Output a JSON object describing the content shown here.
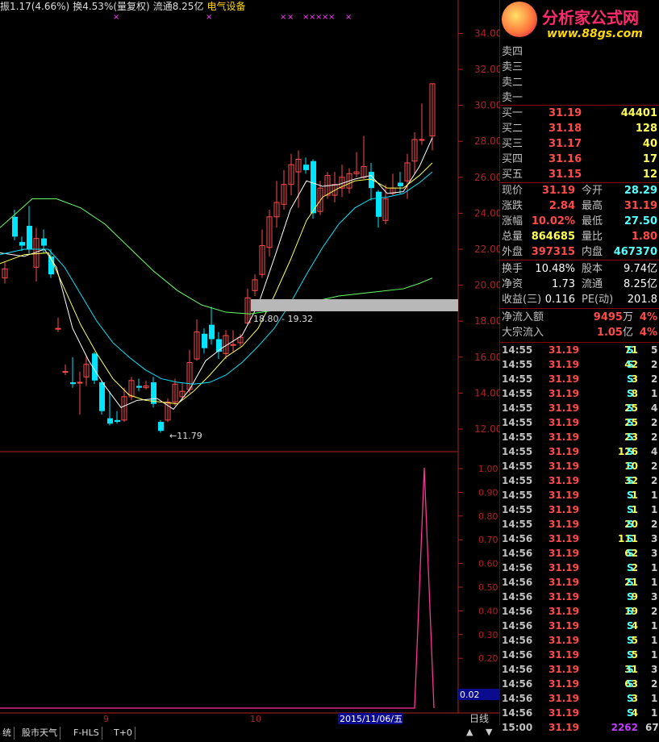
{
  "header": {
    "amp": "振1.17(4.66%)",
    "turnover": "换4.53%(量复权)",
    "float": "流通8.25亿",
    "sector": "电气设备"
  },
  "logo": {
    "name": "分析家公式网",
    "url": "www.88gs.com"
  },
  "price_axis": [
    "34.00",
    "32.00",
    "30.00",
    "28.00",
    "26.00",
    "24.00",
    "22.00",
    "20.00",
    "18.00",
    "16.00",
    "14.00",
    "12.00"
  ],
  "ind_axis": [
    "1.00",
    "0.90",
    "0.80",
    "0.70",
    "0.60",
    "0.50",
    "0.40",
    "0.30",
    "0.20"
  ],
  "ind_value": "0.02",
  "labels": {
    "range": "18.80 - 19.32",
    "low": "11.79",
    "date": "2015/11/06/五",
    "m9": "9",
    "m10": "10",
    "period": "日线"
  },
  "bottom_tabs": [
    "统",
    "股市天气",
    "F-HLS",
    "T+0"
  ],
  "sell": [
    {
      "label": "卖四"
    },
    {
      "label": "卖三"
    },
    {
      "label": "卖二"
    },
    {
      "label": "卖一"
    }
  ],
  "buy": [
    {
      "label": "买一",
      "price": "31.19",
      "vol": "44401"
    },
    {
      "label": "买二",
      "price": "31.18",
      "vol": "128"
    },
    {
      "label": "买三",
      "price": "31.17",
      "vol": "40"
    },
    {
      "label": "买四",
      "price": "31.16",
      "vol": "17"
    },
    {
      "label": "买五",
      "price": "31.15",
      "vol": "12"
    }
  ],
  "stats": [
    {
      "l1": "现价",
      "v1": "31.19",
      "l2": "今开",
      "v2": "28.29",
      "c1": "#ff4a4a",
      "c2": "#5ff"
    },
    {
      "l1": "涨跌",
      "v1": "2.84",
      "l2": "最高",
      "v2": "31.19",
      "c1": "#ff4a4a",
      "c2": "#ff4a4a"
    },
    {
      "l1": "涨幅",
      "v1": "10.02%",
      "l2": "最低",
      "v2": "27.50",
      "c1": "#ff4a4a",
      "c2": "#5ff"
    },
    {
      "l1": "总量",
      "v1": "864685",
      "l2": "量比",
      "v2": "1.80",
      "c1": "#ffff55",
      "c2": "#ff4a4a"
    },
    {
      "l1": "外盘",
      "v1": "397315",
      "l2": "内盘",
      "v2": "467370",
      "c1": "#ff4a4a",
      "c2": "#5ff"
    }
  ],
  "fund": [
    {
      "l1": "换手",
      "v1": "10.48%",
      "l2": "股本",
      "v2": "9.74亿"
    },
    {
      "l1": "净资",
      "v1": "1.73",
      "l2": "流通",
      "v2": "8.25亿"
    },
    {
      "l1": "收益(三)",
      "v1": "0.116",
      "l2": "PE(动)",
      "v2": "201.8"
    }
  ],
  "flow": [
    {
      "label": "净流入额",
      "val": "9495",
      "unit": "万",
      "pct": "4%"
    },
    {
      "label": "大宗流入",
      "val": "1.05",
      "unit": "亿",
      "pct": "4%"
    }
  ],
  "ticks": [
    {
      "t": "14:55",
      "p": "31.19",
      "q": "71",
      "s": "S",
      "n": "5"
    },
    {
      "t": "14:55",
      "p": "31.19",
      "q": "42",
      "s": "S",
      "n": "2"
    },
    {
      "t": "14:55",
      "p": "31.19",
      "q": "3",
      "s": "S",
      "n": "2"
    },
    {
      "t": "14:55",
      "p": "31.19",
      "q": "8",
      "s": "S",
      "n": "1"
    },
    {
      "t": "14:55",
      "p": "31.19",
      "q": "25",
      "s": "S",
      "n": "4"
    },
    {
      "t": "14:55",
      "p": "31.19",
      "q": "25",
      "s": "S",
      "n": "2"
    },
    {
      "t": "14:55",
      "p": "31.19",
      "q": "23",
      "s": "S",
      "n": "2"
    },
    {
      "t": "14:55",
      "p": "31.19",
      "q": "126",
      "s": "S",
      "n": "4"
    },
    {
      "t": "14:55",
      "p": "31.19",
      "q": "10",
      "s": "S",
      "n": "2"
    },
    {
      "t": "14:55",
      "p": "31.19",
      "q": "32",
      "s": "S",
      "n": "2"
    },
    {
      "t": "14:55",
      "p": "31.19",
      "q": "1",
      "s": "S",
      "n": "1"
    },
    {
      "t": "14:55",
      "p": "31.19",
      "q": "1",
      "s": "S",
      "n": "1"
    },
    {
      "t": "14:55",
      "p": "31.19",
      "q": "20",
      "s": "S",
      "n": "2"
    },
    {
      "t": "14:56",
      "p": "31.19",
      "q": "111",
      "s": "S",
      "n": "3"
    },
    {
      "t": "14:56",
      "p": "31.19",
      "q": "62",
      "s": "S",
      "n": "3"
    },
    {
      "t": "14:56",
      "p": "31.19",
      "q": "2",
      "s": "S",
      "n": "1"
    },
    {
      "t": "14:56",
      "p": "31.19",
      "q": "21",
      "s": "S",
      "n": "1"
    },
    {
      "t": "14:56",
      "p": "31.19",
      "q": "9",
      "s": "S",
      "n": "3"
    },
    {
      "t": "14:56",
      "p": "31.19",
      "q": "19",
      "s": "S",
      "n": "2"
    },
    {
      "t": "14:56",
      "p": "31.19",
      "q": "4",
      "s": "S",
      "n": "1"
    },
    {
      "t": "14:56",
      "p": "31.19",
      "q": "5",
      "s": "S",
      "n": "1"
    },
    {
      "t": "14:56",
      "p": "31.19",
      "q": "5",
      "s": "S",
      "n": "1"
    },
    {
      "t": "14:56",
      "p": "31.19",
      "q": "31",
      "s": "S",
      "n": "3"
    },
    {
      "t": "14:56",
      "p": "31.19",
      "q": "63",
      "s": "S",
      "n": "2"
    },
    {
      "t": "14:56",
      "p": "31.19",
      "q": "3",
      "s": "S",
      "n": "1"
    },
    {
      "t": "14:56",
      "p": "31.19",
      "q": "4",
      "s": "S",
      "n": "1"
    },
    {
      "t": "15:00",
      "p": "31.19",
      "q": "2262",
      "s": "",
      "n": "67"
    }
  ],
  "colors": {
    "up": "#ff4a4a",
    "down": "#00e5ff",
    "axis": "#b22222",
    "ma5": "#ffffff",
    "ma10": "#ffff55",
    "ma20": "#00e5ff",
    "ma60": "#66ff66",
    "signal": "#ff3399"
  }
}
